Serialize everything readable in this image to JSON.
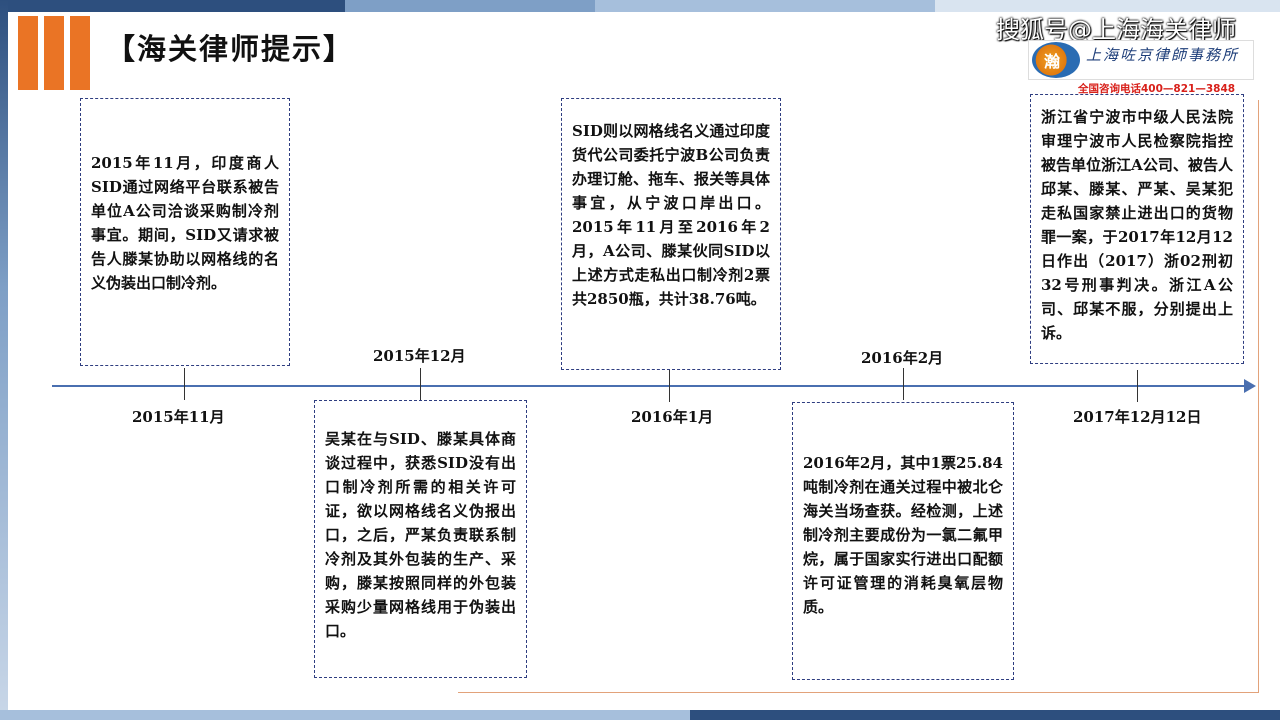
{
  "header": {
    "title": "【海关律师提示】",
    "watermark": "搜狐号@上海海关律师",
    "logo_glyph": "瀚",
    "logo_text": "上海咗京律師事務所",
    "hotline": "全国咨询电话400—821—3848"
  },
  "timeline": {
    "dates": {
      "d1": "2015年11月",
      "d2": "2015年12月",
      "d3": "2016年1月",
      "d4": "2016年2月",
      "d5": "2017年12月12日"
    },
    "events": {
      "e1": "2015年11月，印度商人SID通过网络平台联系被告单位A公司洽谈采购制冷剂事宜。期间，SID又请求被告人滕某协助以网格线的名义伪装出口制冷剂。",
      "e2": "吴某在与SID、滕某具体商谈过程中，获悉SID没有出口制冷剂所需的相关许可证，欲以网格线名义伪报出口，之后，严某负责联系制冷剂及其外包装的生产、采购，滕某按照同样的外包装采购少量网格线用于伪装出口。",
      "e3": "SID则以网格线名义通过印度货代公司委托宁波B公司负责办理订舱、拖车、报关等具体事宜，从宁波口岸出口。2015年11月至2016年2月，A公司、滕某伙同SID以上述方式走私出口制冷剂2票共2850瓶，共计38.76吨。",
      "e4": "2016年2月，其中1票25.84吨制冷剂在通关过程中被北仑海关当场查获。经检测，上述制冷剂主要成份为一氯二氟甲烷，属于国家实行进出口配额许可证管理的消耗臭氧层物质。",
      "e5": "浙江省宁波市中级人民法院审理宁波市人民检察院指控被告单位浙江A公司、被告人邱某、滕某、严某、吴某犯走私国家禁止进出口的货物罪一案，于2017年12月12日作出（2017）浙02刑初32号刑事判决。浙江A公司、邱某不服，分别提出上诉。"
    }
  },
  "colors": {
    "accent_orange": "#ea7425",
    "axis_blue": "#4a6fb0",
    "box_border": "#2e3d80",
    "hotline_red": "#d8201a"
  }
}
